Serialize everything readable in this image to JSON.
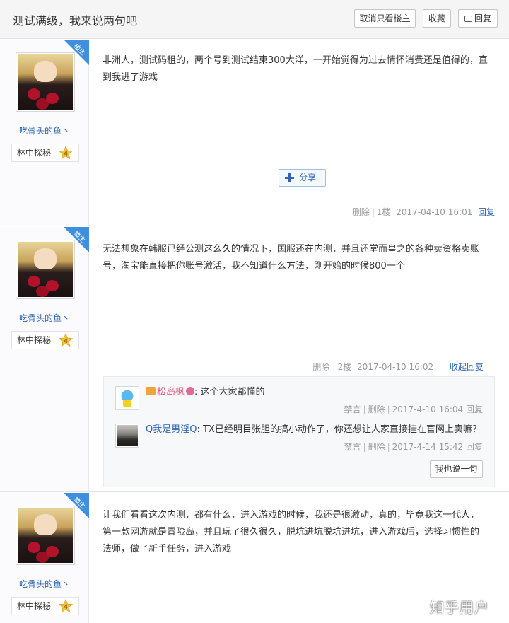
{
  "header": {
    "title": "测试满级，我来说两句吧",
    "btn_only_op": "取消只看楼主",
    "btn_fav": "收藏",
    "btn_reply": "回复",
    "reply_icon": "comment-icon"
  },
  "posts": [
    {
      "badge": "楼主",
      "username": "吃骨头的鱼丶",
      "level_name": "林中探秘",
      "level": "4",
      "content": "非洲人，测试码租的，两个号到测试结束300大洋，一开始觉得为过去情怀消费还是值得的，直到我进了游戏",
      "share": "分享",
      "delete": "删除",
      "floor": "1楼",
      "time": "2017-04-10 16:01",
      "reply": "回复"
    },
    {
      "badge": "楼主",
      "username": "吃骨头的鱼丶",
      "level_name": "林中探秘",
      "level": "4",
      "content": "无法想象在韩服已经公测这么久的情况下，国服还在内测，并且还堂而皇之的各种卖资格卖账号，淘宝能直接把你账号激活，我不知道什么方法，刚开始的时候800一个",
      "delete": "删除",
      "floor": "2楼",
      "time": "2017-04-10 16:02",
      "reply": "收起回复",
      "comments": [
        {
          "user": "松岛枫",
          "text": ": 这个大家都懂的",
          "ban": "禁言",
          "delete": "删除",
          "time": "2017-4-10 16:04",
          "reply": "回复"
        },
        {
          "user": "Q我是男淫Q",
          "text": ": TX已经明目张胆的搞小动作了，你还想让人家直接挂在官网上卖嘛？",
          "ban": "禁言",
          "delete": "删除",
          "time": "2017-4-14 15:42",
          "reply": "回复"
        }
      ],
      "say_btn": "我也说一句"
    },
    {
      "badge": "楼主",
      "username": "吃骨头的鱼丶",
      "level_name": "林中探秘",
      "level": "4",
      "content": "让我们看看这次内测，都有什么，进入游戏的时候，我还是很激动，真的，毕竟我这一代人，第一款网游就是冒险岛，并且玩了很久很久，脱坑进坑脱坑进坑，进入游戏后，选择习惯性的法师，做了新手任务，进入游戏"
    }
  ],
  "watermark": "知乎用户",
  "colors": {
    "link": "#2d64b3",
    "badge": "#3f8fde",
    "level_star": "#f5c342"
  }
}
